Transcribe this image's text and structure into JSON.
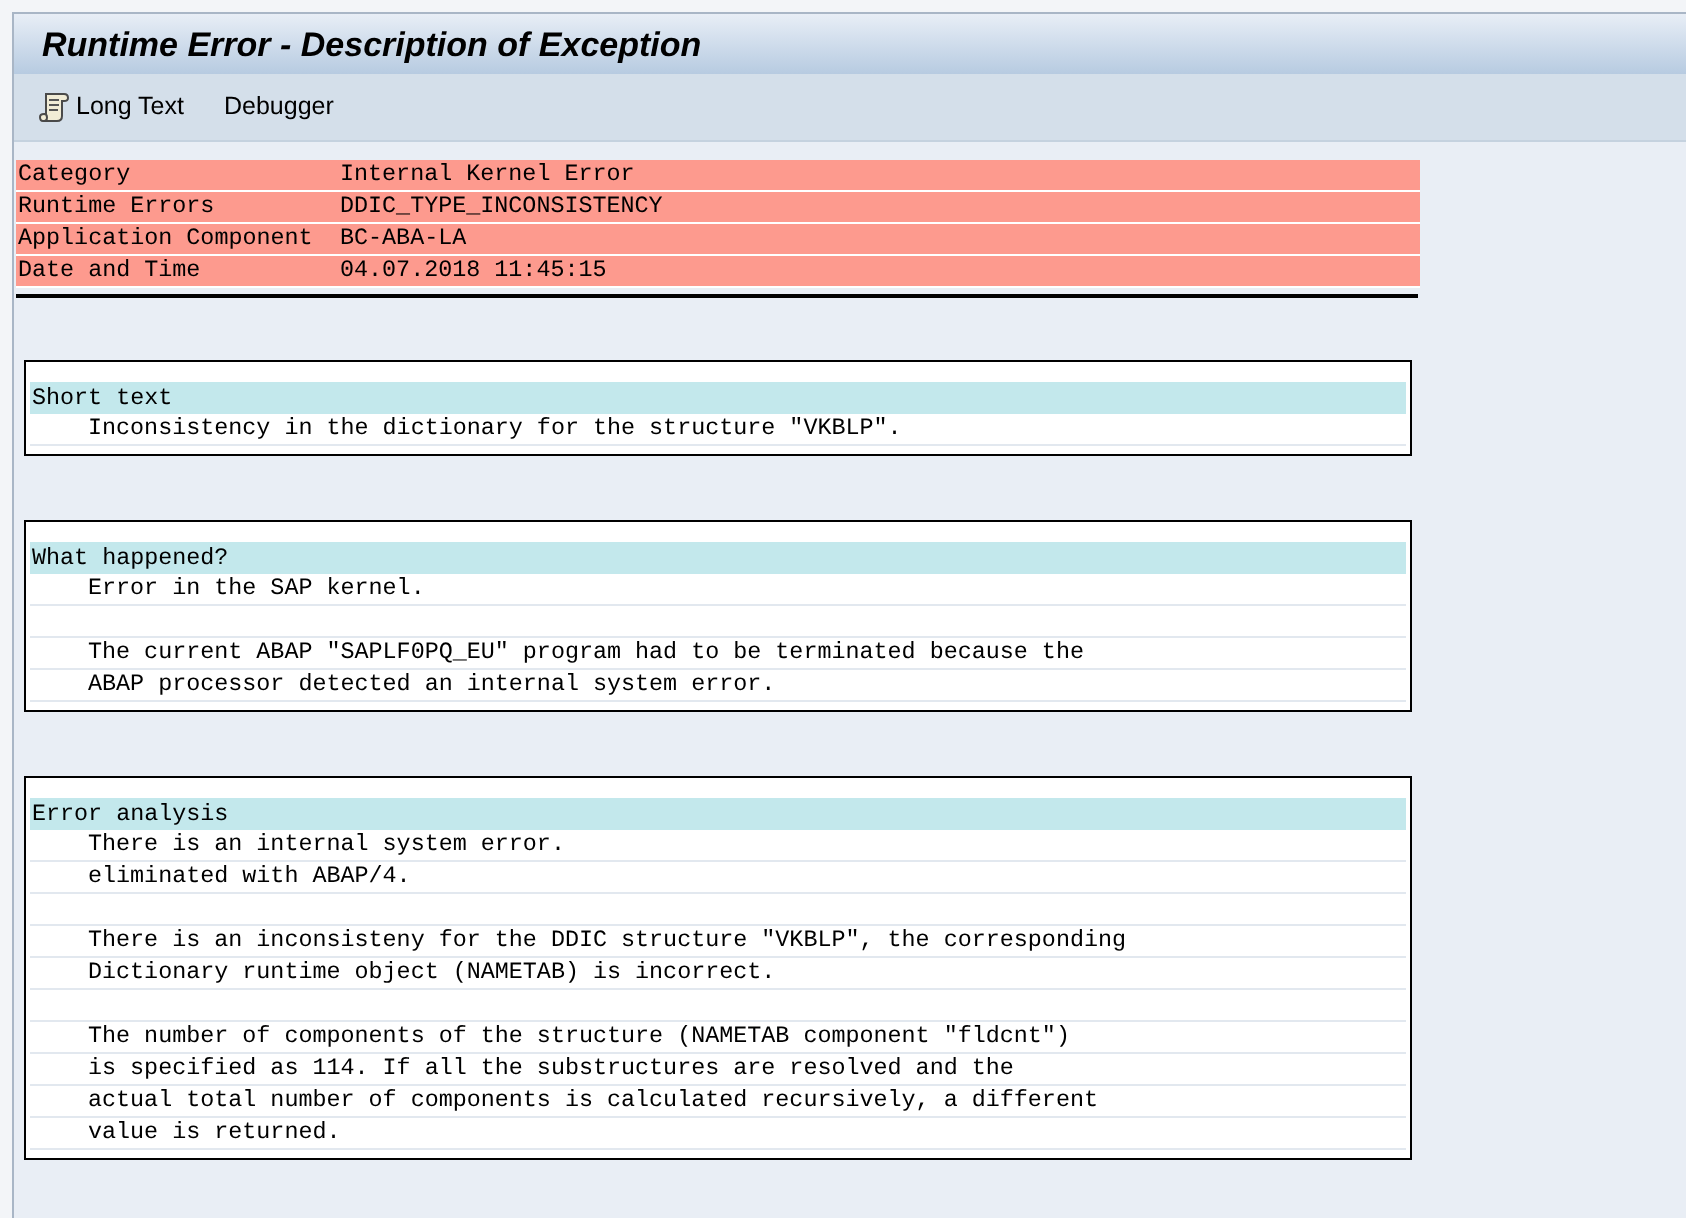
{
  "window": {
    "title": "Runtime Error - Description of Exception"
  },
  "toolbar": [
    {
      "kind": "with_icon",
      "label": "Long Text"
    },
    {
      "kind": "plain",
      "label": "Debugger"
    }
  ],
  "header": [
    {
      "label": "Category",
      "value": "Internal Kernel Error"
    },
    {
      "label": "Runtime Errors",
      "value": "DDIC_TYPE_INCONSISTENCY"
    },
    {
      "label": "Application Component",
      "value": "BC-ABA-LA"
    },
    {
      "label": "Date and Time",
      "value": "04.07.2018 11:45:15"
    }
  ],
  "sections": [
    {
      "title": "Short text",
      "paragraphs": [
        [
          "Inconsistency in the dictionary for the structure \"VKBLP\"."
        ]
      ]
    },
    {
      "title": "What happened?",
      "paragraphs": [
        [
          "Error in the SAP kernel."
        ],
        [
          "The current ABAP \"SAPLF0PQ_EU\" program had to be terminated because the",
          "ABAP processor detected an internal system error."
        ]
      ]
    },
    {
      "title": "Error analysis",
      "paragraphs": [
        [
          "There is an internal system error.",
          "eliminated with ABAP/4."
        ],
        [
          "There is an inconsisteny for the DDIC structure \"VKBLP\", the corresponding",
          "Dictionary runtime object (NAMETAB) is incorrect."
        ],
        [
          "The number of components of the structure (NAMETAB component \"fldcnt\")",
          "is specified as 114. If all the substructures are resolved and the",
          "actual total number of components is calculated recursively, a different",
          "value is returned."
        ]
      ]
    }
  ]
}
